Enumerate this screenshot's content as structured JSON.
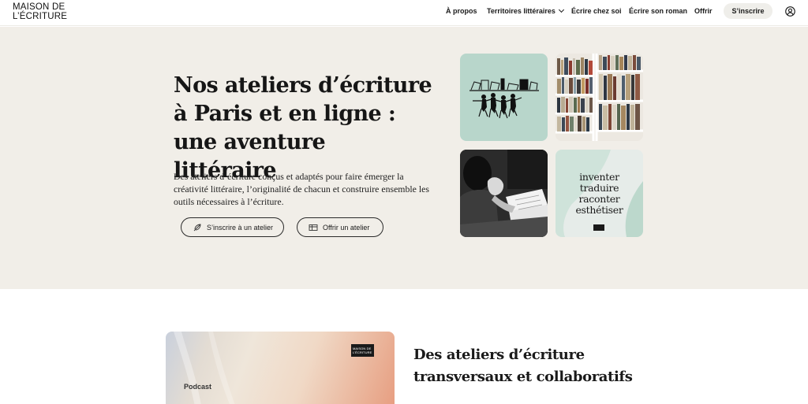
{
  "brand": {
    "line1": "MAISON DE",
    "line2": "L’ÉCRITURE"
  },
  "nav": {
    "items": [
      {
        "label": "À propos"
      },
      {
        "label": "Territoires littéraires",
        "has_dropdown": true
      },
      {
        "label": "Écrire chez soi"
      },
      {
        "label": "Écrire son roman"
      },
      {
        "label": "Offrir"
      }
    ],
    "signup_label": "S’inscrire",
    "account_icon": "user-circle-icon"
  },
  "hero": {
    "title_regular": "Nos ateliers d’écriture à Paris et en ligne : ",
    "title_bold": "une aventure littéraire",
    "description": "Des ateliers d’écriture conçus et adaptés pour faire émerger la créativité littéraire, l’originalité de chacun et construire ensemble les outils nécessaires à l’écriture.",
    "buttons": [
      {
        "label": "S’inscrire à un atelier",
        "icon": "feather-pen-icon"
      },
      {
        "label": "Offrir un atelier",
        "icon": "gift-card-icon"
      }
    ],
    "words_tile": [
      "inventer",
      "traduire",
      "raconter",
      "esthétiser"
    ]
  },
  "feature": {
    "tag": "Podcast",
    "badge_line1": "MAISON DE",
    "badge_line2": "L’ÉCRITURE",
    "section_title": "Des ateliers d’écriture transversaux et collaboratifs"
  },
  "colors": {
    "hero_background": "#f1eee8",
    "tile_mint": "#b8d6cb",
    "signup_button": "#efeeea"
  }
}
